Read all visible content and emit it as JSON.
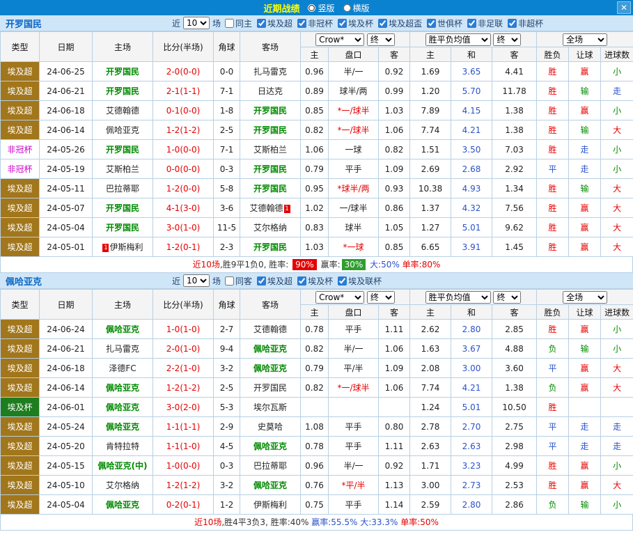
{
  "colors": {
    "titlebar_bg": "#0b82cf",
    "title_text": "#ffff00",
    "teambar_bg": "#cfe6f8",
    "team_name": "#0a66c2",
    "border": "#b7cfe4",
    "score_red": "#e60000",
    "focus_green": "#008a00",
    "avg_draw_blue": "#2952cc",
    "badge_win_bg": "#e60000",
    "badge_handicap_bg": "#2f9e2f"
  },
  "titlebar": {
    "title": "近期战绩",
    "layout_options": [
      {
        "label": "竖版",
        "selected": true
      },
      {
        "label": "横版",
        "selected": false
      }
    ],
    "close_icon": "✕"
  },
  "table_header": {
    "type": "类型",
    "date": "日期",
    "home": "主场",
    "score": "比分(半场)",
    "corner": "角球",
    "away": "客场",
    "odds_company": "Crow*",
    "odds_final": "终",
    "avg_label": "胜平负均值",
    "avg_final": "终",
    "fullmatch_label": "全场",
    "sub": {
      "odds_home": "主",
      "handicap": "盘口",
      "odds_away": "客",
      "avg_home": "主",
      "avg_draw": "和",
      "avg_away": "客",
      "outcome": "胜负",
      "handicap_result": "让球",
      "goals": "进球数"
    }
  },
  "league_styles": {
    "埃及超": {
      "bg": "#a2761b",
      "fg": "#ffffff"
    },
    "非冠杯": {
      "bg": "#ffffff",
      "fg": "#cc00cc"
    },
    "埃及杯": {
      "bg": "#1e7d1e",
      "fg": "#ffffff"
    }
  },
  "result_colors": {
    "胜": "#e60000",
    "赢": "#e60000",
    "大": "#e60000",
    "平": "#2952cc",
    "走": "#2952cc",
    "负": "#008a00",
    "输": "#008a00",
    "小": "#008a00"
  },
  "sections": [
    {
      "team": "开罗国民",
      "filter": {
        "near_label": "近",
        "count": "10",
        "games_label": "场",
        "checkboxes": [
          {
            "label": "同主",
            "checked": false
          },
          {
            "label": "埃及超",
            "checked": true
          },
          {
            "label": "非冠杯",
            "checked": true
          },
          {
            "label": "埃及杯",
            "checked": true
          },
          {
            "label": "埃及超盃",
            "checked": true
          },
          {
            "label": "世俱杯",
            "checked": true
          },
          {
            "label": "非足联",
            "checked": true
          },
          {
            "label": "非超杯",
            "checked": true
          }
        ]
      },
      "rows": [
        {
          "league": "埃及超",
          "date": "24-06-25",
          "home": {
            "name": "开罗国民",
            "focus": true
          },
          "score": "2-0(0-0)",
          "corner": "0-0",
          "away": {
            "name": "扎马雷克",
            "focus": false
          },
          "odds": {
            "home": "0.96",
            "handicap": "半/一",
            "away": "0.92",
            "handicap_red": false
          },
          "avg": {
            "home": "1.69",
            "draw": "3.65",
            "away": "4.41"
          },
          "result": {
            "outcome": "胜",
            "handicap": "赢",
            "goals": "小"
          }
        },
        {
          "league": "埃及超",
          "date": "24-06-21",
          "home": {
            "name": "开罗国民",
            "focus": true
          },
          "score": "2-1(1-1)",
          "corner": "7-1",
          "away": {
            "name": "日达克",
            "focus": false
          },
          "odds": {
            "home": "0.89",
            "handicap": "球半/两",
            "away": "0.99",
            "handicap_red": false
          },
          "avg": {
            "home": "1.20",
            "draw": "5.70",
            "away": "11.78"
          },
          "result": {
            "outcome": "胜",
            "handicap": "输",
            "goals": "走"
          }
        },
        {
          "league": "埃及超",
          "date": "24-06-18",
          "home": {
            "name": "艾德翰德",
            "focus": false
          },
          "score": "0-1(0-0)",
          "corner": "1-8",
          "away": {
            "name": "开罗国民",
            "focus": true
          },
          "odds": {
            "home": "0.85",
            "handicap": "*一/球半",
            "away": "1.03",
            "handicap_red": true
          },
          "avg": {
            "home": "7.89",
            "draw": "4.15",
            "away": "1.38"
          },
          "result": {
            "outcome": "胜",
            "handicap": "赢",
            "goals": "小"
          }
        },
        {
          "league": "埃及超",
          "date": "24-06-14",
          "home": {
            "name": "佩哈亚克",
            "focus": false
          },
          "score": "1-2(1-2)",
          "corner": "2-5",
          "away": {
            "name": "开罗国民",
            "focus": true
          },
          "odds": {
            "home": "0.82",
            "handicap": "*一/球半",
            "away": "1.06",
            "handicap_red": true
          },
          "avg": {
            "home": "7.74",
            "draw": "4.21",
            "away": "1.38"
          },
          "result": {
            "outcome": "胜",
            "handicap": "输",
            "goals": "大"
          }
        },
        {
          "league": "非冠杯",
          "date": "24-05-26",
          "home": {
            "name": "开罗国民",
            "focus": true
          },
          "score": "1-0(0-0)",
          "corner": "7-1",
          "away": {
            "name": "艾斯柏兰",
            "focus": false
          },
          "odds": {
            "home": "1.06",
            "handicap": "一球",
            "away": "0.82",
            "handicap_red": false
          },
          "avg": {
            "home": "1.51",
            "draw": "3.50",
            "away": "7.03"
          },
          "result": {
            "outcome": "胜",
            "handicap": "走",
            "goals": "小"
          }
        },
        {
          "league": "非冠杯",
          "date": "24-05-19",
          "home": {
            "name": "艾斯柏兰",
            "focus": false
          },
          "score": "0-0(0-0)",
          "corner": "0-3",
          "away": {
            "name": "开罗国民",
            "focus": true
          },
          "odds": {
            "home": "0.79",
            "handicap": "平手",
            "away": "1.09",
            "handicap_red": false
          },
          "avg": {
            "home": "2.69",
            "draw": "2.68",
            "away": "2.92"
          },
          "result": {
            "outcome": "平",
            "handicap": "走",
            "goals": "小"
          }
        },
        {
          "league": "埃及超",
          "date": "24-05-11",
          "home": {
            "name": "巴拉蒂耶",
            "focus": false
          },
          "score": "1-2(0-0)",
          "corner": "5-8",
          "away": {
            "name": "开罗国民",
            "focus": true
          },
          "odds": {
            "home": "0.95",
            "handicap": "*球半/两",
            "away": "0.93",
            "handicap_red": true
          },
          "avg": {
            "home": "10.38",
            "draw": "4.93",
            "away": "1.34"
          },
          "result": {
            "outcome": "胜",
            "handicap": "输",
            "goals": "大"
          }
        },
        {
          "league": "埃及超",
          "date": "24-05-07",
          "home": {
            "name": "开罗国民",
            "focus": true
          },
          "score": "4-1(3-0)",
          "corner": "3-6",
          "away": {
            "name": "艾德翰德",
            "focus": false,
            "red_card": {
              "count": "1",
              "position": "after"
            }
          },
          "odds": {
            "home": "1.02",
            "handicap": "一/球半",
            "away": "0.86",
            "handicap_red": false
          },
          "avg": {
            "home": "1.37",
            "draw": "4.32",
            "away": "7.56"
          },
          "result": {
            "outcome": "胜",
            "handicap": "赢",
            "goals": "大"
          }
        },
        {
          "league": "埃及超",
          "date": "24-05-04",
          "home": {
            "name": "开罗国民",
            "focus": true
          },
          "score": "3-0(1-0)",
          "corner": "11-5",
          "away": {
            "name": "艾尔格纳",
            "focus": false
          },
          "odds": {
            "home": "0.83",
            "handicap": "球半",
            "away": "1.05",
            "handicap_red": false
          },
          "avg": {
            "home": "1.27",
            "draw": "5.01",
            "away": "9.62"
          },
          "result": {
            "outcome": "胜",
            "handicap": "赢",
            "goals": "大"
          }
        },
        {
          "league": "埃及超",
          "date": "24-05-01",
          "home": {
            "name": "伊斯梅利",
            "focus": false,
            "red_card": {
              "count": "1",
              "position": "before"
            }
          },
          "score": "1-2(0-1)",
          "corner": "2-3",
          "away": {
            "name": "开罗国民",
            "focus": true
          },
          "odds": {
            "home": "1.03",
            "handicap": "*一球",
            "away": "0.85",
            "handicap_red": true
          },
          "avg": {
            "home": "6.65",
            "draw": "3.91",
            "away": "1.45"
          },
          "result": {
            "outcome": "胜",
            "handicap": "赢",
            "goals": "大"
          }
        }
      ],
      "summary": [
        {
          "text": "近10场",
          "color": "#e60000"
        },
        {
          "text": ",胜9平1负0, 胜率: ",
          "color": "#333333"
        },
        {
          "text": "90%",
          "badge": "#e60000"
        },
        {
          "text": " 赢率:",
          "color": "#333333"
        },
        {
          "text": "30%",
          "badge": "#2f9e2f"
        },
        {
          "text": " 大:50% ",
          "color": "#2952cc"
        },
        {
          "text": "单率:80%",
          "color": "#e60000"
        }
      ]
    },
    {
      "team": "佩哈亚克",
      "filter": {
        "near_label": "近",
        "count": "10",
        "games_label": "场",
        "checkboxes": [
          {
            "label": "同客",
            "checked": false
          },
          {
            "label": "埃及超",
            "checked": true
          },
          {
            "label": "埃及杯",
            "checked": true
          },
          {
            "label": "埃及联杯",
            "checked": true
          }
        ]
      },
      "rows": [
        {
          "league": "埃及超",
          "date": "24-06-24",
          "home": {
            "name": "佩哈亚克",
            "focus": true
          },
          "score": "1-0(1-0)",
          "corner": "2-7",
          "away": {
            "name": "艾德翰德",
            "focus": false
          },
          "odds": {
            "home": "0.78",
            "handicap": "平手",
            "away": "1.11",
            "handicap_red": false
          },
          "avg": {
            "home": "2.62",
            "draw": "2.80",
            "away": "2.85"
          },
          "result": {
            "outcome": "胜",
            "handicap": "赢",
            "goals": "小"
          }
        },
        {
          "league": "埃及超",
          "date": "24-06-21",
          "home": {
            "name": "扎马雷克",
            "focus": false
          },
          "score": "2-0(1-0)",
          "corner": "9-4",
          "away": {
            "name": "佩哈亚克",
            "focus": true
          },
          "odds": {
            "home": "0.82",
            "handicap": "半/一",
            "away": "1.06",
            "handicap_red": false
          },
          "avg": {
            "home": "1.63",
            "draw": "3.67",
            "away": "4.88"
          },
          "result": {
            "outcome": "负",
            "handicap": "输",
            "goals": "小"
          }
        },
        {
          "league": "埃及超",
          "date": "24-06-18",
          "home": {
            "name": "泽德FC",
            "focus": false
          },
          "score": "2-2(1-0)",
          "corner": "3-2",
          "away": {
            "name": "佩哈亚克",
            "focus": true
          },
          "odds": {
            "home": "0.79",
            "handicap": "平/半",
            "away": "1.09",
            "handicap_red": false
          },
          "avg": {
            "home": "2.08",
            "draw": "3.00",
            "away": "3.60"
          },
          "result": {
            "outcome": "平",
            "handicap": "赢",
            "goals": "大"
          }
        },
        {
          "league": "埃及超",
          "date": "24-06-14",
          "home": {
            "name": "佩哈亚克",
            "focus": true
          },
          "score": "1-2(1-2)",
          "corner": "2-5",
          "away": {
            "name": "开罗国民",
            "focus": false
          },
          "odds": {
            "home": "0.82",
            "handicap": "*一/球半",
            "away": "1.06",
            "handicap_red": true
          },
          "avg": {
            "home": "7.74",
            "draw": "4.21",
            "away": "1.38"
          },
          "result": {
            "outcome": "负",
            "handicap": "赢",
            "goals": "大"
          }
        },
        {
          "league": "埃及杯",
          "date": "24-06-01",
          "home": {
            "name": "佩哈亚克",
            "focus": true
          },
          "score": "3-0(2-0)",
          "corner": "5-3",
          "away": {
            "name": "埃尔瓦斯",
            "focus": false
          },
          "odds": {
            "home": "",
            "handicap": "",
            "away": "",
            "handicap_red": false
          },
          "avg": {
            "home": "1.24",
            "draw": "5.01",
            "away": "10.50"
          },
          "result": {
            "outcome": "胜",
            "handicap": "",
            "goals": ""
          }
        },
        {
          "league": "埃及超",
          "date": "24-05-24",
          "home": {
            "name": "佩哈亚克",
            "focus": true
          },
          "score": "1-1(1-1)",
          "corner": "2-9",
          "away": {
            "name": "史莫哈",
            "focus": false
          },
          "odds": {
            "home": "1.08",
            "handicap": "平手",
            "away": "0.80",
            "handicap_red": false
          },
          "avg": {
            "home": "2.78",
            "draw": "2.70",
            "away": "2.75"
          },
          "result": {
            "outcome": "平",
            "handicap": "走",
            "goals": "走"
          }
        },
        {
          "league": "埃及超",
          "date": "24-05-20",
          "home": {
            "name": "肯特拉特",
            "focus": false
          },
          "score": "1-1(1-0)",
          "corner": "4-5",
          "away": {
            "name": "佩哈亚克",
            "focus": true
          },
          "odds": {
            "home": "0.78",
            "handicap": "平手",
            "away": "1.11",
            "handicap_red": false
          },
          "avg": {
            "home": "2.63",
            "draw": "2.63",
            "away": "2.98"
          },
          "result": {
            "outcome": "平",
            "handicap": "走",
            "goals": "走"
          }
        },
        {
          "league": "埃及超",
          "date": "24-05-15",
          "home": {
            "name": "佩哈亚克(中)",
            "focus": true
          },
          "score": "1-0(0-0)",
          "corner": "0-3",
          "away": {
            "name": "巴拉蒂耶",
            "focus": false
          },
          "odds": {
            "home": "0.96",
            "handicap": "半/一",
            "away": "0.92",
            "handicap_red": false
          },
          "avg": {
            "home": "1.71",
            "draw": "3.23",
            "away": "4.99"
          },
          "result": {
            "outcome": "胜",
            "handicap": "赢",
            "goals": "小"
          }
        },
        {
          "league": "埃及超",
          "date": "24-05-10",
          "home": {
            "name": "艾尔格纳",
            "focus": false
          },
          "score": "1-2(1-2)",
          "corner": "3-2",
          "away": {
            "name": "佩哈亚克",
            "focus": true
          },
          "odds": {
            "home": "0.76",
            "handicap": "*平/半",
            "away": "1.13",
            "handicap_red": true
          },
          "avg": {
            "home": "3.00",
            "draw": "2.73",
            "away": "2.53"
          },
          "result": {
            "outcome": "胜",
            "handicap": "赢",
            "goals": "大"
          }
        },
        {
          "league": "埃及超",
          "date": "24-05-04",
          "home": {
            "name": "佩哈亚克",
            "focus": true
          },
          "score": "0-2(0-1)",
          "corner": "1-2",
          "away": {
            "name": "伊斯梅利",
            "focus": false
          },
          "odds": {
            "home": "0.75",
            "handicap": "平手",
            "away": "1.14",
            "handicap_red": false
          },
          "avg": {
            "home": "2.59",
            "draw": "2.80",
            "away": "2.86"
          },
          "result": {
            "outcome": "负",
            "handicap": "输",
            "goals": "小"
          }
        }
      ],
      "summary": [
        {
          "text": "近10场",
          "color": "#e60000"
        },
        {
          "text": ",胜4平3负3, 胜率:40% ",
          "color": "#333333"
        },
        {
          "text": "赢率:55.5% ",
          "color": "#2952cc"
        },
        {
          "text": "大:33.3% ",
          "color": "#2952cc"
        },
        {
          "text": "单率:50%",
          "color": "#e60000"
        }
      ]
    }
  ]
}
